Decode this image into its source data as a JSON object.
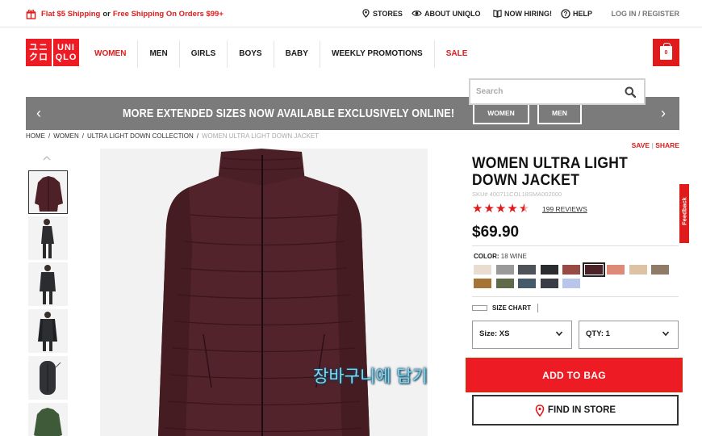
{
  "topbar": {
    "promo_free": "Flat $5 Shipping",
    "promo_or": "or",
    "promo_ship": "Free Shipping On Orders $99+",
    "stores": "STORES",
    "about": "ABOUT UNIQLO",
    "hiring": "NOW HIRING!",
    "help": "HELP",
    "login": "LOG IN / REGISTER"
  },
  "logo": {
    "top_left": "ユニ",
    "top_right": "UNI",
    "bottom_left": "クロ",
    "bottom_right": "QLO"
  },
  "nav": {
    "items": [
      "WOMEN",
      "MEN",
      "GIRLS",
      "BOYS",
      "BABY",
      "WEEKLY PROMOTIONS",
      "SALE"
    ]
  },
  "bag": {
    "count": "0"
  },
  "search": {
    "placeholder": "Search"
  },
  "banner": {
    "text": "MORE EXTENDED SIZES NOW AVAILABLE EXCLUSIVELY ONLINE!",
    "btn_women": "WOMEN",
    "btn_men": "MEN",
    "left_arrow": "‹",
    "right_arrow": "›"
  },
  "breadcrumb": {
    "home": "HOME",
    "women": "WOMEN",
    "collection": "ULTRA LIGHT DOWN COLLECTION",
    "current": "WOMEN ULTRA LIGHT DOWN JACKET",
    "sep": "/"
  },
  "product": {
    "save": "SAVE",
    "share": "SHARE",
    "title": "WOMEN ULTRA LIGHT DOWN JACKET",
    "sku": "SKU# 400711COL18SMA002000",
    "rating": 4.5,
    "reviews": "199 REVIEWS",
    "price": "$69.90",
    "color_label": "COLOR:",
    "color_value": "18 WINE",
    "swatches": [
      "#e8ddd0",
      "#9a9a9a",
      "#4d5358",
      "#2b2c2e",
      "#9a4a45",
      "#4a2228",
      "#dd8a78",
      "#dcc3a6",
      "#8e7b68",
      "#a57335",
      "#5e6a4a",
      "#455b6a",
      "#3a3c46",
      "#b7c6ea"
    ],
    "selected_swatch": 5,
    "size_chart": "SIZE CHART",
    "size": "Size: XS",
    "qty": "QTY: 1",
    "add_to_bag": "ADD TO BAG",
    "find_in_store": "FIND IN STORE"
  },
  "feedback": "Feedback",
  "overlay_text": "장바구니에 담기",
  "colors": {
    "brand_red": "#ed1c24",
    "banner_gray": "#7b7b7b",
    "jacket": "#4d2127"
  }
}
